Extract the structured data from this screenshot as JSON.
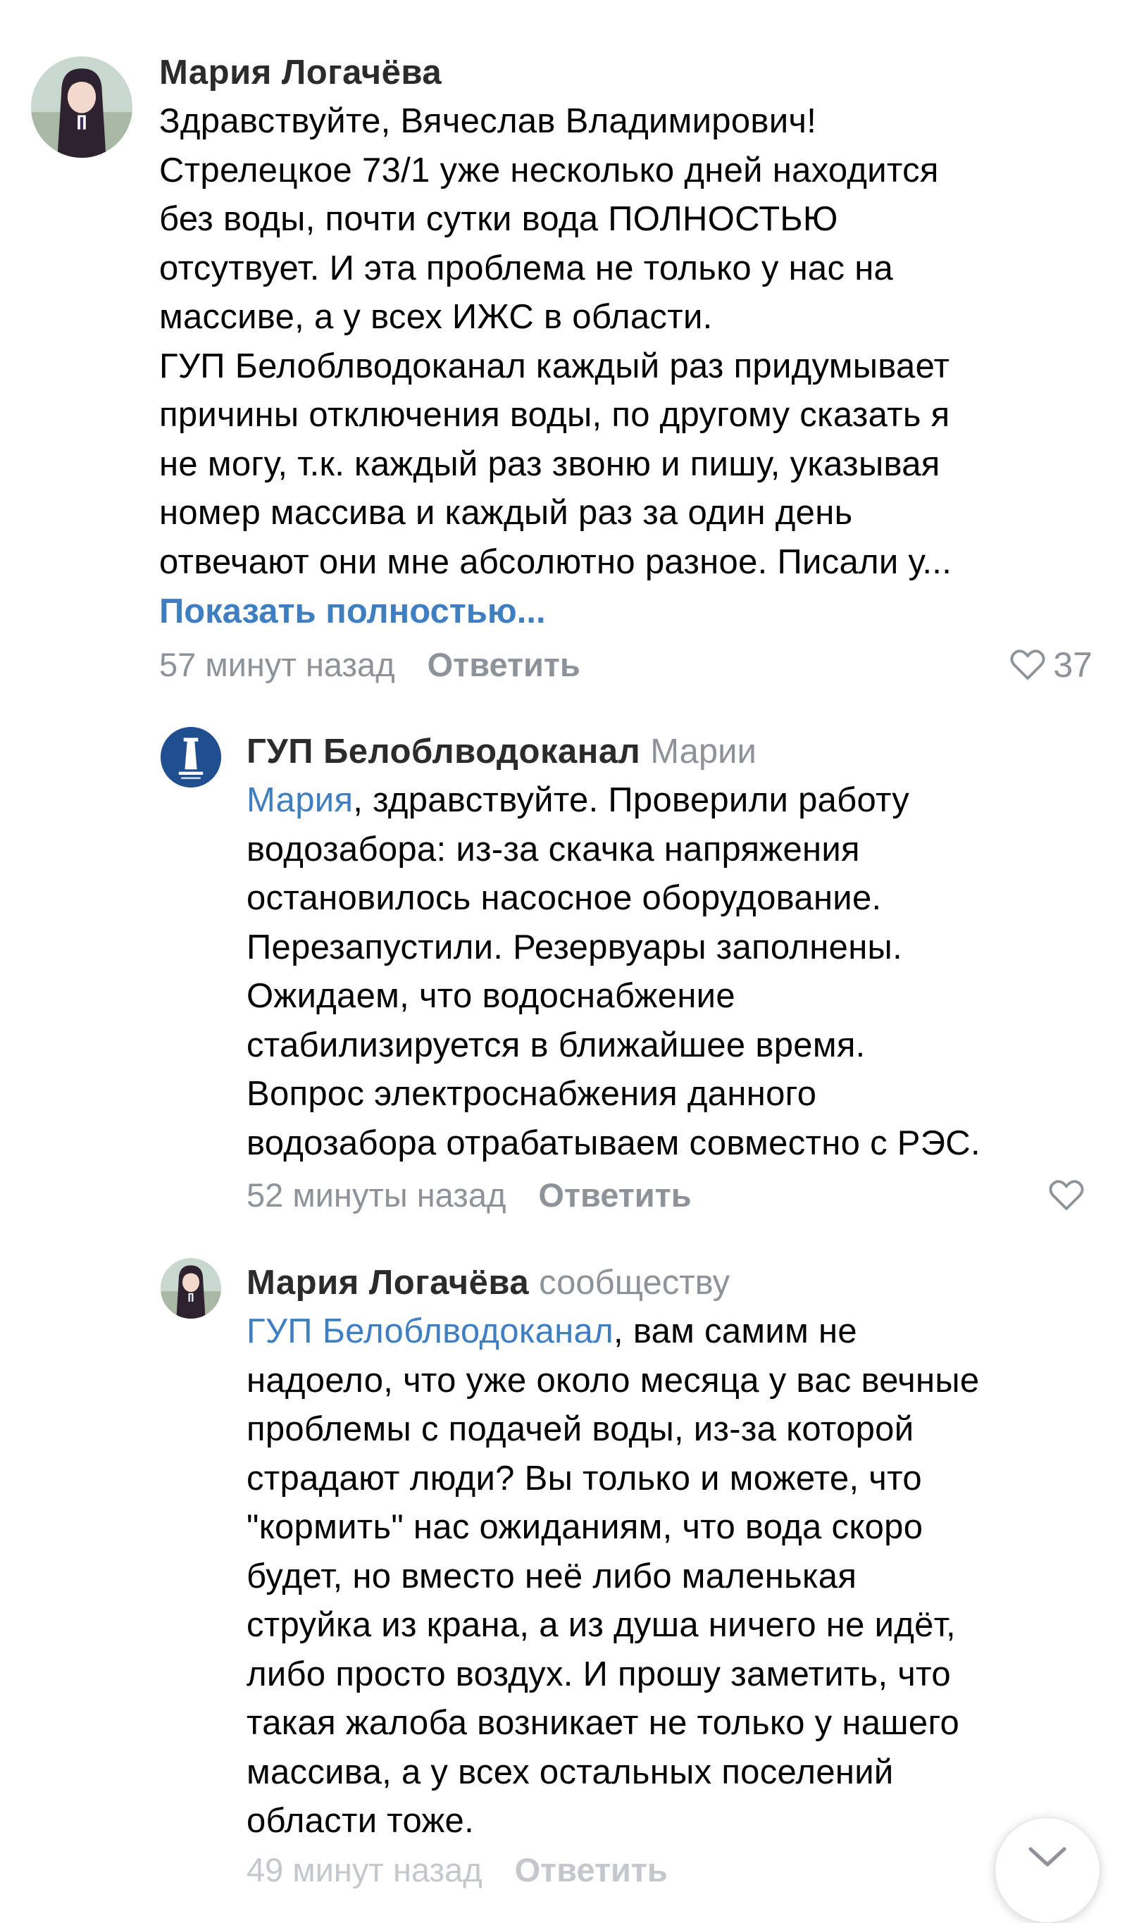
{
  "comments": [
    {
      "author": "Мария Логачёва",
      "reply_to": "",
      "mention": "",
      "text": "Здравствуйте, Вячеслав Владимирович!\nСтрелецкое 73/1 уже несколько дней находится\nбез воды, почти сутки вода ПОЛНОСТЬЮ\nотсутвует. И эта проблема не только у нас на\nмассиве, а у всех ИЖС в области.\nГУП Белоблводоканал каждый раз придумывает\nпричины отключения воды, по другому сказать я\nне могу, т.к. каждый раз звоню и пишу, указывая\nномер массива и каждый раз за один день\nотвечают они мне абсолютно разное. Писали у...",
      "show_more": "Показать полностью...",
      "time": "57 минут назад",
      "reply_label": "Ответить",
      "likes": "37"
    },
    {
      "author": "ГУП Белоблводоканал",
      "reply_to": "Марии",
      "mention": "Мария",
      "text": ", здравствуйте. Проверили работу\nводозабора: из-за скачка напряжения\nостановилось насосное оборудование.\nПерезапустили. Резервуары заполнены.\nОжидаем, что водоснабжение\nстабилизируется в ближайшее время.\nВопрос электроснабжения данного\nводозабора отрабатываем совместно с РЭС.",
      "time": "52 минуты назад",
      "reply_label": "Ответить",
      "likes": ""
    },
    {
      "author": "Мария Логачёва",
      "reply_to": "сообществу",
      "mention": "ГУП Белоблводоканал",
      "text": ", вам самим не\nнадоело, что уже около месяца у вас вечные\nпроблемы с подачей воды, из-за которой\nстрадают люди? Вы только и можете, что\n\"кормить\" нас ожиданиям, что вода скоро\nбудет, но вместо неё либо маленькая\nструйка из крана, а из душа ничего не идёт,\nлибо просто воздух. И прошу заметить, что\nтакая жалоба возникает не только у нашего\nмассива, а у всех остальных поселений\nобласти тоже.",
      "time": "49 минут назад",
      "reply_label": "Ответить"
    }
  ],
  "icons": {
    "like": "heart-icon",
    "scroll": "chevron-down-icon"
  },
  "colors": {
    "link": "#3f7fc1",
    "muted": "#8e9399",
    "text": "#000000",
    "author": "#2b2b2b"
  }
}
